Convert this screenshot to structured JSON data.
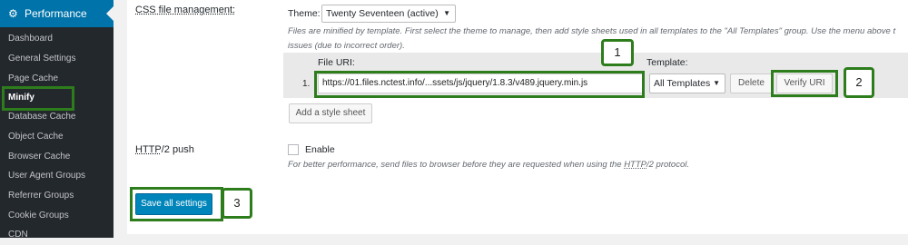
{
  "sidebar": {
    "header": {
      "icon": "gear-icon",
      "label": "Performance"
    },
    "items": [
      {
        "label": "Dashboard"
      },
      {
        "label": "General Settings"
      },
      {
        "label": "Page Cache"
      },
      {
        "label": "Minify"
      },
      {
        "label": "Database Cache"
      },
      {
        "label": "Object Cache"
      },
      {
        "label": "Browser Cache"
      },
      {
        "label": "User Agent Groups"
      },
      {
        "label": "Referrer Groups"
      },
      {
        "label": "Cookie Groups"
      },
      {
        "label": "CDN"
      }
    ]
  },
  "css_management": {
    "title": "CSS file management:",
    "theme_label": "Theme:",
    "theme_value": "Twenty Seventeen (active)",
    "description_line1": "Files are minified by template. First select the theme to manage, then add style sheets used in all templates to the \"All Templates\" group. Use the menu above t",
    "description_line2": "issues (due to incorrect order).",
    "file_uri_header": "File URI:",
    "template_header": "Template:",
    "row_number": "1.",
    "file_uri_value": "https://01.files.nctest.info/...ssets/js/jquery/1.8.3/v489.jquery.min.js",
    "template_value": "All Templates",
    "delete_label": "Delete",
    "verify_label": "Verify URI",
    "add_label": "Add a style sheet"
  },
  "http2": {
    "label_prefix": "HTTP",
    "label_suffix": "/2 push",
    "checkbox_label": "Enable",
    "description_prefix": "For better performance, send files to browser before they are requested when using the ",
    "description_http": "HTTP",
    "description_suffix": "/2 protocol."
  },
  "save_label": "Save all settings",
  "callouts": {
    "one": "1",
    "two": "2",
    "three": "3"
  },
  "colors": {
    "sidebar_bg": "#23282d",
    "active": "#0073aa",
    "highlight": "#2e7d1d",
    "primary": "#0085ba"
  }
}
